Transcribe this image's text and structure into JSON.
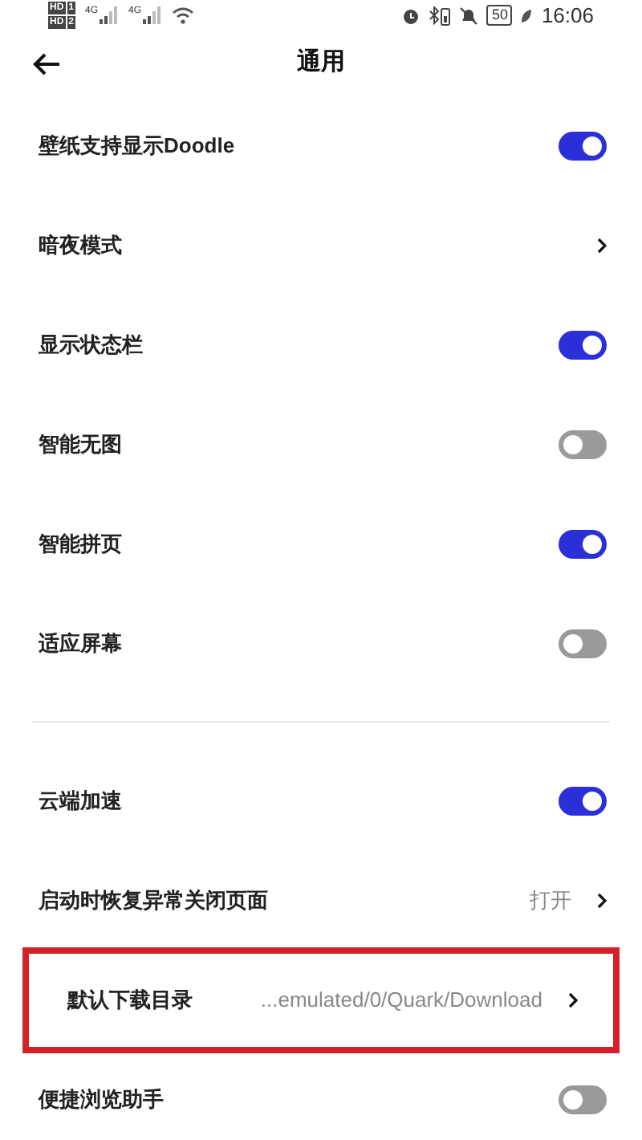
{
  "status_bar": {
    "sims": [
      {
        "tag": "HD",
        "slot": "1"
      },
      {
        "tag": "HD",
        "slot": "2"
      }
    ],
    "networks": [
      "4G",
      "4G"
    ],
    "battery": "50",
    "time": "16:06"
  },
  "header": {
    "title": "通用"
  },
  "sections": [
    {
      "items": [
        {
          "kind": "toggle",
          "label": "壁纸支持显示Doodle",
          "on": true
        },
        {
          "kind": "link",
          "label": "暗夜模式"
        },
        {
          "kind": "toggle",
          "label": "显示状态栏",
          "on": true
        },
        {
          "kind": "toggle",
          "label": "智能无图",
          "on": false
        },
        {
          "kind": "toggle",
          "label": "智能拼页",
          "on": true
        },
        {
          "kind": "toggle",
          "label": "适应屏幕",
          "on": false
        }
      ]
    },
    {
      "items": [
        {
          "kind": "toggle",
          "label": "云端加速",
          "on": true
        },
        {
          "kind": "link",
          "label": "启动时恢复异常关闭页面",
          "value": "打开"
        },
        {
          "kind": "link",
          "label": "默认下载目录",
          "value": "...emulated/0/Quark/Download",
          "highlighted": true
        },
        {
          "kind": "toggle",
          "label": "便捷浏览助手",
          "on": false
        }
      ]
    }
  ]
}
